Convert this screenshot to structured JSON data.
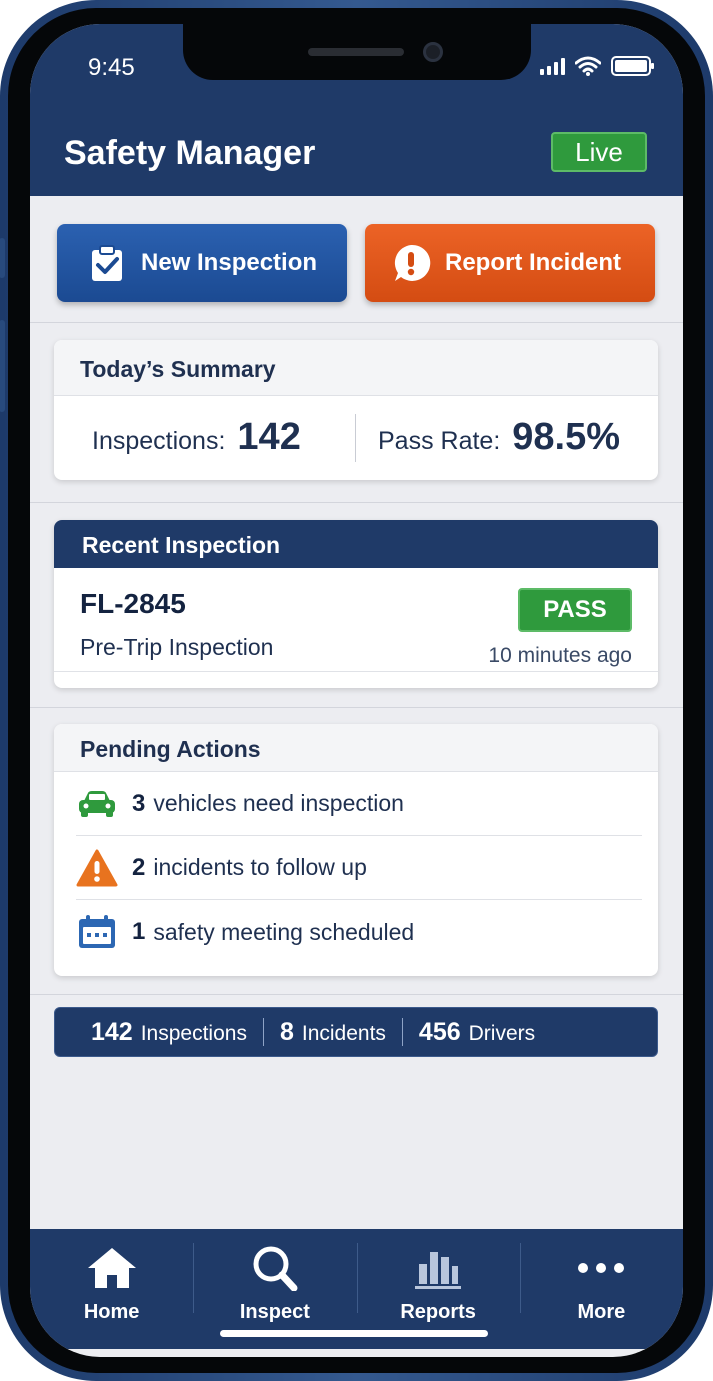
{
  "status_bar": {
    "time": "9:45"
  },
  "header": {
    "title": "Safety Manager",
    "live_badge": "Live"
  },
  "actions": {
    "new_inspection": "New Inspection",
    "report_incident": "Report Incident"
  },
  "summary": {
    "title": "Today’s Summary",
    "inspections_label": "Inspections:",
    "inspections_value": "142",
    "pass_rate_label": "Pass Rate:",
    "pass_rate_value": "98.5%"
  },
  "recent": {
    "title": "Recent Inspection",
    "vehicle_id": "FL-2845",
    "type": "Pre-Trip Inspection",
    "status": "PASS",
    "time_ago": "10 minutes ago"
  },
  "pending": {
    "title": "Pending Actions",
    "items": [
      {
        "icon": "car-icon",
        "count": "3",
        "text": "vehicles need inspection"
      },
      {
        "icon": "warning-icon",
        "count": "2",
        "text": "incidents to follow up"
      },
      {
        "icon": "calendar-icon",
        "count": "1",
        "text": "safety meeting scheduled"
      }
    ]
  },
  "stats": [
    {
      "value": "142",
      "label": "Inspections"
    },
    {
      "value": "8",
      "label": "Incidents"
    },
    {
      "value": "456",
      "label": "Drivers"
    }
  ],
  "tabs": [
    {
      "icon": "home-icon",
      "label": "Home"
    },
    {
      "icon": "search-icon",
      "label": "Inspect"
    },
    {
      "icon": "bar-chart-icon",
      "label": "Reports"
    },
    {
      "icon": "more-icon",
      "label": "More"
    }
  ],
  "colors": {
    "navy": "#1f3a68",
    "primary_blue": "#1b4a92",
    "incident_orange": "#d44c12",
    "success_green": "#2f9a3d",
    "warning_orange": "#e8731f",
    "calendar_blue": "#2c67b3"
  }
}
